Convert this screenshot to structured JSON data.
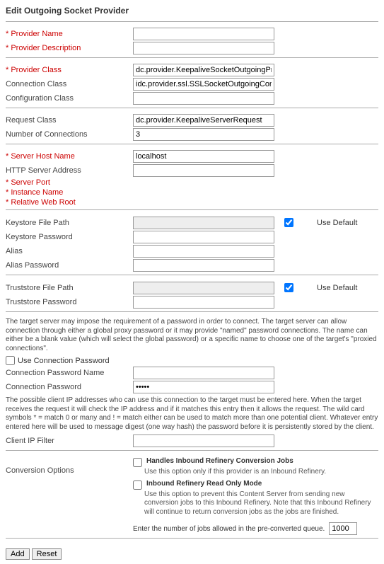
{
  "title": "Edit Outgoing Socket Provider",
  "labels": {
    "provider_name": "* Provider Name",
    "provider_description": "* Provider Description",
    "provider_class": "* Provider Class",
    "connection_class": "Connection Class",
    "configuration_class": "Configuration Class",
    "request_class": "Request Class",
    "number_of_connections": "Number of Connections",
    "server_host_name": "* Server Host Name",
    "http_server_address": "HTTP Server Address",
    "server_port": "* Server Port",
    "instance_name": "* Instance Name",
    "relative_web_root": "* Relative Web Root",
    "keystore_file_path": "Keystore File Path",
    "keystore_password": "Keystore Password",
    "alias": "Alias",
    "alias_password": "Alias Password",
    "truststore_file_path": "Truststore File Path",
    "truststore_password": "Truststore Password",
    "use_connection_password": "Use Connection Password",
    "connection_password_name": "Connection Password Name",
    "connection_password": "Connection Password",
    "client_ip_filter": "Client IP Filter",
    "conversion_options": "Conversion Options",
    "use_default": "Use Default"
  },
  "values": {
    "provider_name": "",
    "provider_description": "",
    "provider_class": "dc.provider.KeepaliveSocketOutgoingProvider",
    "connection_class": "idc.provider.ssl.SSLSocketOutgoingConnection",
    "configuration_class": "",
    "request_class": "dc.provider.KeepaliveServerRequest",
    "number_of_connections": "3",
    "server_host_name": "localhost",
    "http_server_address": "",
    "server_port": "",
    "instance_name": "",
    "relative_web_root": "",
    "keystore_file_path": "",
    "keystore_password": "",
    "alias": "",
    "alias_password": "",
    "truststore_file_path": "",
    "truststore_password": "",
    "connection_password_name": "",
    "connection_password": "•••••",
    "client_ip_filter": "",
    "jobs_allowed": "1000"
  },
  "checks": {
    "keystore_use_default": true,
    "truststore_use_default": true,
    "use_connection_password": false,
    "handles_conversion_jobs": false,
    "refinery_read_only": false
  },
  "notes": {
    "password_note": "The target server may impose the requirement of a password in order to connect. The target server can allow connection through either a global proxy password or it may provide \"named\" password connections. The name can either be a blank value (which will select the global password) or a specific name to choose one of the target's \"proxied connections\".",
    "ip_note": "The possible client IP addresses who can use this connection to the target must be entered here. When the target receives the request it will check the IP address and if it matches this entry then it allows the request. The wild card symbols * = match 0 or many and ! = match either can be used to match more than one potential client. Whatever entry entered here will be used to message digest (one way hash) the password before it is persistently stored by the client."
  },
  "conversion": {
    "handles_label": "Handles Inbound Refinery Conversion Jobs",
    "handles_sub": "Use this option only if this provider is an Inbound Refinery.",
    "readonly_label": "Inbound Refinery Read Only Mode",
    "readonly_sub": "Use this option to prevent this Content Server from sending new conversion jobs to this Inbound Refinery. Note that this Inbound Refinery will continue to return conversion jobs as the jobs are finished.",
    "quota_label": "Enter the number of jobs allowed in the pre-converted queue."
  },
  "buttons": {
    "add": "Add",
    "reset": "Reset"
  }
}
